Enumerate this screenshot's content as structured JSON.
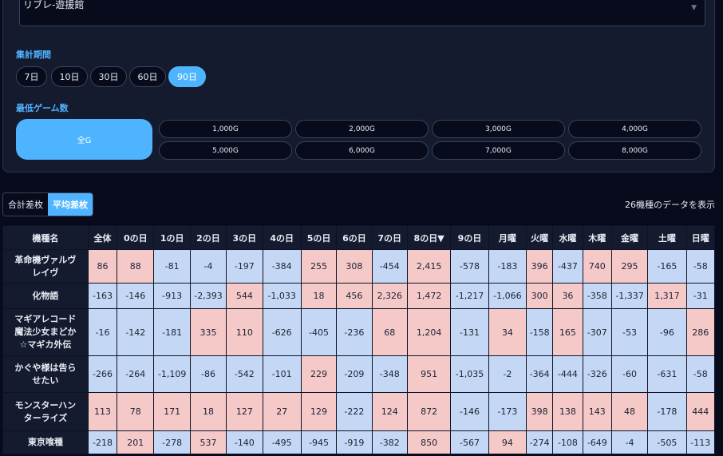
{
  "venue_select": {
    "value": "リブレ-遊援館"
  },
  "period": {
    "label": "集計期間",
    "options": [
      "7日",
      "10日",
      "30日",
      "60日",
      "90日"
    ],
    "active_index": 4
  },
  "min_games": {
    "label": "最低ゲーム数",
    "all_label": "全G",
    "options": [
      "1,000G",
      "2,000G",
      "3,000G",
      "4,000G",
      "5,000G",
      "6,000G",
      "7,000G",
      "8,000G"
    ]
  },
  "view_toggle": {
    "total_label": "合計差枚",
    "avg_label": "平均差枚",
    "active": "avg"
  },
  "result_count": "26機種のデータを表示",
  "table": {
    "headers": [
      "機種名",
      "全体",
      "0の日",
      "1の日",
      "2の日",
      "3の日",
      "4の日",
      "5の日",
      "6の日",
      "7の日",
      "8の日▼",
      "9の日",
      "月曜",
      "火曜",
      "水曜",
      "木曜",
      "金曜",
      "土曜",
      "日曜"
    ],
    "rows": [
      {
        "name": [
          "革命機ヴァルヴ",
          "レイヴ"
        ],
        "values": [
          "86",
          "88",
          "-81",
          "-4",
          "-197",
          "-384",
          "255",
          "308",
          "-454",
          "2,415",
          "-578",
          "-183",
          "396",
          "-437",
          "740",
          "295",
          "-165",
          "-58"
        ]
      },
      {
        "name": [
          "化物語"
        ],
        "values": [
          "-163",
          "-146",
          "-913",
          "-2,393",
          "544",
          "-1,033",
          "18",
          "456",
          "2,326",
          "1,472",
          "-1,217",
          "-1,066",
          "300",
          "36",
          "-358",
          "-1,337",
          "1,317",
          "-31"
        ]
      },
      {
        "name": [
          "マギアレコード",
          "魔法少女まどか",
          "☆マギカ外伝"
        ],
        "values": [
          "-16",
          "-142",
          "-181",
          "335",
          "110",
          "-626",
          "-405",
          "-236",
          "68",
          "1,204",
          "-131",
          "34",
          "-158",
          "165",
          "-307",
          "-53",
          "-96",
          "286"
        ]
      },
      {
        "name": [
          "かぐや様は告ら",
          "せたい"
        ],
        "values": [
          "-266",
          "-264",
          "-1,109",
          "-86",
          "-542",
          "-101",
          "229",
          "-209",
          "-348",
          "951",
          "-1,035",
          "-2",
          "-364",
          "-444",
          "-326",
          "-60",
          "-631",
          "-58"
        ]
      },
      {
        "name": [
          "モンスターハン",
          "ターライズ"
        ],
        "values": [
          "113",
          "78",
          "171",
          "18",
          "127",
          "27",
          "129",
          "-222",
          "124",
          "872",
          "-146",
          "-173",
          "398",
          "138",
          "143",
          "48",
          "-178",
          "444"
        ]
      },
      {
        "name": [
          "東京喰種"
        ],
        "values": [
          "-218",
          "201",
          "-278",
          "537",
          "-140",
          "-495",
          "-945",
          "-919",
          "-382",
          "850",
          "-567",
          "94",
          "-274",
          "-108",
          "-649",
          "-4",
          "-505",
          "-113"
        ]
      }
    ]
  }
}
